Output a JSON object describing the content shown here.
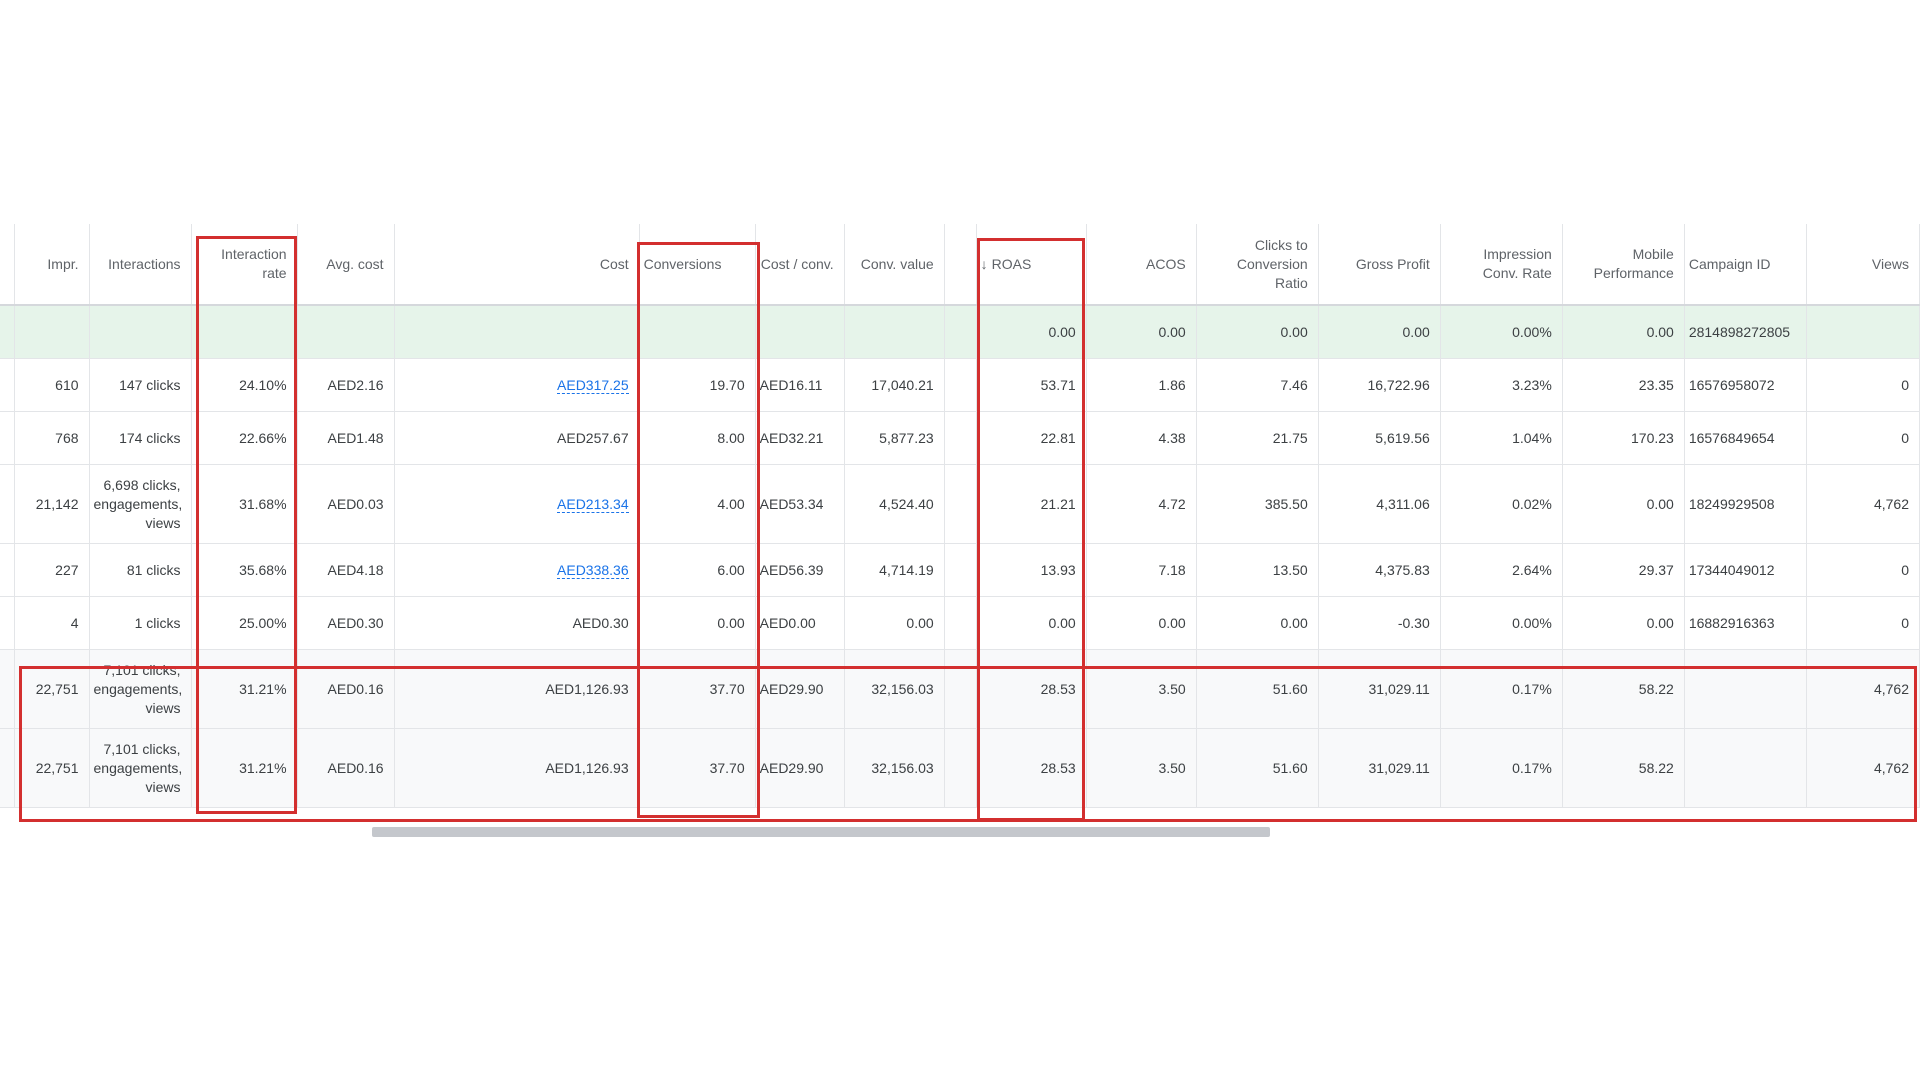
{
  "columns": [
    {
      "key": "impr",
      "label": "Impr."
    },
    {
      "key": "interactions",
      "label": "Interactions"
    },
    {
      "key": "interaction_rate",
      "label": "Interaction rate"
    },
    {
      "key": "avg_cost",
      "label": "Avg. cost"
    },
    {
      "key": "cost",
      "label": "Cost"
    },
    {
      "key": "conversions",
      "label": "Conversions"
    },
    {
      "key": "cost_conv",
      "label": "Cost / conv."
    },
    {
      "key": "conv_value",
      "label": "Conv. value"
    },
    {
      "key": "roas",
      "label": "ROAS",
      "sort_icon": "arrow-down-icon"
    },
    {
      "key": "acos",
      "label": "ACOS"
    },
    {
      "key": "clicks_ratio",
      "label": "Clicks to Conversion Ratio"
    },
    {
      "key": "gross_profit",
      "label": "Gross Profit"
    },
    {
      "key": "impr_conv_rate",
      "label": "Impression Conv. Rate"
    },
    {
      "key": "mobile_perf",
      "label": "Mobile Performance"
    },
    {
      "key": "campaign_id",
      "label": "Campaign ID"
    },
    {
      "key": "views",
      "label": "Views"
    }
  ],
  "total_row": {
    "roas": "0.00",
    "acos": "0.00",
    "clicks_ratio": "0.00",
    "gross_profit": "0.00",
    "impr_conv_rate": "0.00%",
    "mobile_perf": "0.00",
    "campaign_id": "2814898272805"
  },
  "rows": [
    {
      "impr": "610",
      "interactions": "147 clicks",
      "interaction_rate": "24.10%",
      "avg_cost": "AED2.16",
      "cost": "AED317.25",
      "cost_link": true,
      "conversions": "19.70",
      "cost_conv": "AED16.11",
      "conv_value": "17,040.21",
      "roas": "53.71",
      "acos": "1.86",
      "clicks_ratio": "7.46",
      "gross_profit": "16,722.96",
      "impr_conv_rate": "3.23%",
      "mobile_perf": "23.35",
      "campaign_id": "16576958072",
      "views": "0"
    },
    {
      "impr": "768",
      "interactions": "174 clicks",
      "interaction_rate": "22.66%",
      "avg_cost": "AED1.48",
      "cost": "AED257.67",
      "cost_link": false,
      "conversions": "8.00",
      "cost_conv": "AED32.21",
      "conv_value": "5,877.23",
      "roas": "22.81",
      "acos": "4.38",
      "clicks_ratio": "21.75",
      "gross_profit": "5,619.56",
      "impr_conv_rate": "1.04%",
      "mobile_perf": "170.23",
      "campaign_id": "16576849654",
      "views": "0"
    },
    {
      "impr": "21,142",
      "interactions": "6,698 clicks, engagements, views",
      "interaction_rate": "31.68%",
      "avg_cost": "AED0.03",
      "cost": "AED213.34",
      "cost_link": true,
      "conversions": "4.00",
      "cost_conv": "AED53.34",
      "conv_value": "4,524.40",
      "roas": "21.21",
      "acos": "4.72",
      "clicks_ratio": "385.50",
      "gross_profit": "4,311.06",
      "impr_conv_rate": "0.02%",
      "mobile_perf": "0.00",
      "campaign_id": "18249929508",
      "views": "4,762"
    },
    {
      "impr": "227",
      "interactions": "81 clicks",
      "interaction_rate": "35.68%",
      "avg_cost": "AED4.18",
      "cost": "AED338.36",
      "cost_link": true,
      "conversions": "6.00",
      "cost_conv": "AED56.39",
      "conv_value": "4,714.19",
      "roas": "13.93",
      "acos": "7.18",
      "clicks_ratio": "13.50",
      "gross_profit": "4,375.83",
      "impr_conv_rate": "2.64%",
      "mobile_perf": "29.37",
      "campaign_id": "17344049012",
      "views": "0"
    },
    {
      "impr": "4",
      "interactions": "1 clicks",
      "interaction_rate": "25.00%",
      "avg_cost": "AED0.30",
      "cost": "AED0.30",
      "cost_link": false,
      "conversions": "0.00",
      "cost_conv": "AED0.00",
      "conv_value": "0.00",
      "roas": "0.00",
      "acos": "0.00",
      "clicks_ratio": "0.00",
      "gross_profit": "-0.30",
      "impr_conv_rate": "0.00%",
      "mobile_perf": "0.00",
      "campaign_id": "16882916363",
      "views": "0"
    }
  ],
  "summary_rows": [
    {
      "impr": "22,751",
      "interactions": "7,101 clicks, engagements, views",
      "interaction_rate": "31.21%",
      "avg_cost": "AED0.16",
      "cost": "AED1,126.93",
      "cost_link": false,
      "conversions": "37.70",
      "cost_conv": "AED29.90",
      "conv_value": "32,156.03",
      "roas": "28.53",
      "acos": "3.50",
      "clicks_ratio": "51.60",
      "gross_profit": "31,029.11",
      "impr_conv_rate": "0.17%",
      "mobile_perf": "58.22",
      "campaign_id": "",
      "views": "4,762"
    },
    {
      "impr": "22,751",
      "interactions": "7,101 clicks, engagements, views",
      "interaction_rate": "31.21%",
      "avg_cost": "AED0.16",
      "cost": "AED1,126.93",
      "cost_link": false,
      "conversions": "37.70",
      "cost_conv": "AED29.90",
      "conv_value": "32,156.03",
      "roas": "28.53",
      "acos": "3.50",
      "clicks_ratio": "51.60",
      "gross_profit": "31,029.11",
      "impr_conv_rate": "0.17%",
      "mobile_perf": "58.22",
      "campaign_id": "",
      "views": "4,762"
    }
  ],
  "highlight_color": "#d32f2f",
  "total_row_color": "#e6f4ea",
  "link_color": "#1a73e8",
  "horizontal_scroll_position": 0.19
}
